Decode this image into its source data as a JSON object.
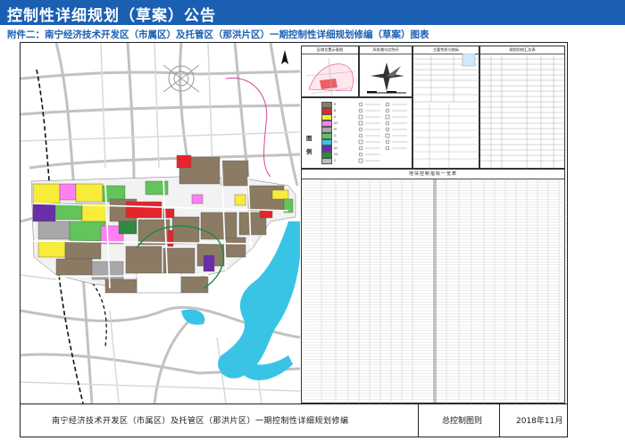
{
  "banner": {
    "title": "控制性详细规划（草案）公告"
  },
  "subtitle": "附件二：南宁经济技术开发区（市属区）及托管区（那洪片区）一期控制性详细规划修编（草案）图表",
  "panels": {
    "location": "区域位置示意图",
    "wind": "风玫瑰与比例尺",
    "indicators": "主要性质与指标",
    "landuse": "规划用地汇总表",
    "legend_head": "图例",
    "table": "地块控制指标一览表"
  },
  "colors": {
    "residential": "#8c7b64",
    "commercial": "#e6242b",
    "industrial": "#a8a8a8",
    "public": "#f7ec3a",
    "education": "#ff7ff0",
    "admin": "#6a2fa8",
    "green": "#62c45a",
    "green_dark": "#2e8b3f",
    "water": "#39c4e6",
    "road": "#bcbcbc",
    "banner": "#1b5fb3"
  },
  "footer": {
    "main": "南宁经济技术开发区（市属区）及托管区（那洪片区）一期控制性详细规划修编",
    "name": "总控制图则",
    "date": "2018年11月"
  }
}
